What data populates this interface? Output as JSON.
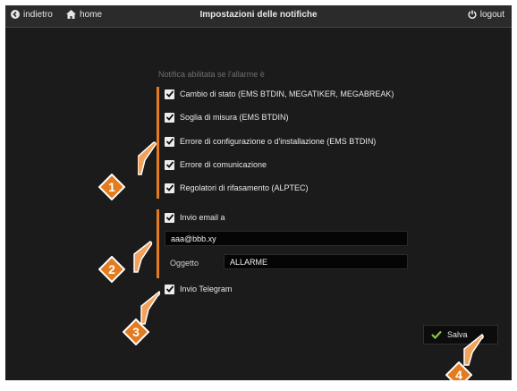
{
  "header": {
    "back_label": "indietro",
    "home_label": "home",
    "title": "Impostazioni delle notifiche",
    "logout_label": "logout"
  },
  "alarms": {
    "title": "Notifica abilitata se l'allarme è",
    "items": [
      {
        "label": "Cambio di stato (EMS BTDIN, MEGATIKER, MEGABREAK)",
        "checked": true
      },
      {
        "label": "Soglia di misura (EMS BTDIN)",
        "checked": true
      },
      {
        "label": "Errore di configurazione o d'installazione (EMS BTDIN)",
        "checked": true
      },
      {
        "label": "Errore di comunicazione",
        "checked": true
      },
      {
        "label": "Regolatori di rifasamento (ALPTEC)",
        "checked": true
      }
    ]
  },
  "email": {
    "label": "Invio email a",
    "checked": true,
    "address": "aaa@bbb.xy",
    "subject_label": "Oggetto",
    "subject_value": "ALLARME"
  },
  "telegram": {
    "label": "Invio Telegram",
    "checked": true
  },
  "save_label": "Salva",
  "callouts": [
    "1",
    "2",
    "3",
    "4"
  ],
  "colors": {
    "accent": "#e47b1f",
    "check": "#8cc63f",
    "background": "#1b1b1b"
  }
}
